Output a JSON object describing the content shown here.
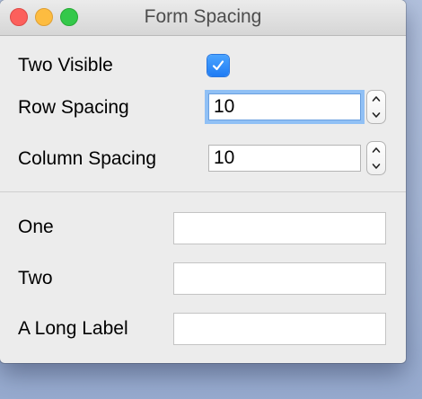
{
  "window": {
    "title": "Form Spacing"
  },
  "top_form": {
    "two_visible": {
      "label": "Two Visible",
      "checked": true
    },
    "row_spacing": {
      "label": "Row Spacing",
      "value": "10"
    },
    "column_spacing": {
      "label": "Column Spacing",
      "value": "10"
    }
  },
  "bottom_form": {
    "one_label": "One",
    "two_label": "Two",
    "long_label": "A Long Label"
  },
  "colors": {
    "accent": "#1f7cf4",
    "focus_ring": "#90c0f5",
    "close": "#fc605c",
    "minimize": "#fdbc40",
    "zoom": "#34c84a"
  }
}
